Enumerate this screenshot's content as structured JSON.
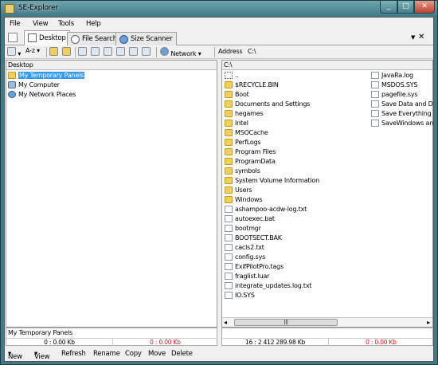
{
  "window": {
    "title": "SE-Explorer"
  },
  "menu": [
    "File",
    "View",
    "Tools",
    "Help"
  ],
  "tabs": [
    {
      "label": "Desktop"
    },
    {
      "label": "File Search"
    },
    {
      "label": "Size Scanner"
    }
  ],
  "toolbar": {
    "sort_label": "A-z",
    "network_label": "Network",
    "address_label": "Address",
    "address_value": "C:\\"
  },
  "left_panel": {
    "header": "Desktop",
    "items": [
      "My Temporary Panels",
      "My Computer",
      "My Network Places"
    ],
    "status_name": "My Temporary Panels",
    "status_count": "0 : 0.00 Kb",
    "status_selected": "0 : 0.00 Kb"
  },
  "right_panel": {
    "header": "C:\\",
    "up": "..",
    "col1": [
      "$RECYCLE.BIN",
      "Boot",
      "Documents and Settings",
      "hegames",
      "Intel",
      "MSOCache",
      "PerfLogs",
      "Program Files",
      "ProgramData",
      "symbols",
      "System Volume Information",
      "Users",
      "Windows",
      "ashampoo-acdw-log.txt",
      "autoexec.bat",
      "bootmgr",
      "BOOTSECT.BAK",
      "cacls2.txt",
      "config.sys",
      "ExifPilotPro.tags",
      "fraglist.luar",
      "integrate_updates.log.txt",
      "IO.SYS"
    ],
    "col2": [
      "JavaRa.log",
      "MSDOS.SYS",
      "pagefile.sys",
      "Save Data and Doc",
      "Save Everything On",
      "SaveWindows and"
    ],
    "status_count": "16 : 2 412 289.98 Kb",
    "status_selected": "0 : 0.00 Kb"
  },
  "bottom": [
    "New",
    "View",
    "Refresh",
    "Rename",
    "Copy",
    "Move",
    "Delete"
  ],
  "colors": {
    "selection": "#3399ff",
    "folder": "#f2cf5a",
    "status_red": "#d02020"
  }
}
